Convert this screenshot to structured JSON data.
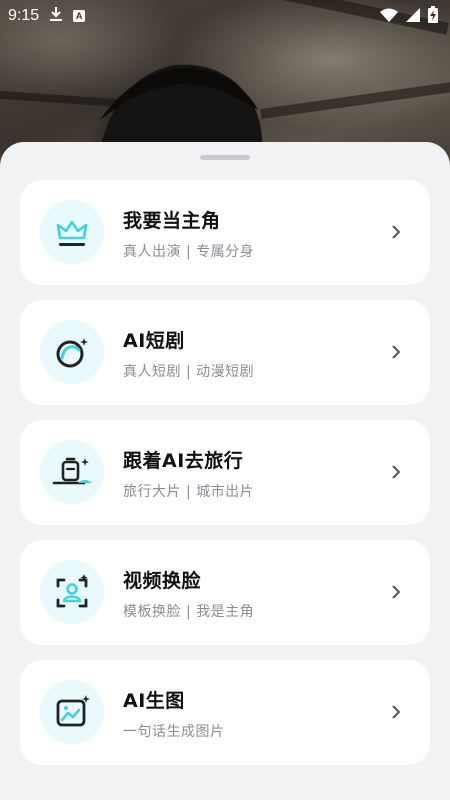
{
  "status_bar": {
    "time": "9:15",
    "icons": [
      "download-icon",
      "a-badge-icon",
      "wifi-icon",
      "signal-icon",
      "battery-charging-icon"
    ],
    "a_badge": "A"
  },
  "colors": {
    "accent": "#3fd3e0",
    "icon_dark": "#222222",
    "icon_bg": "#eaf9fb",
    "sheet_bg": "#f1f2f4",
    "subtitle": "#8a8d94"
  },
  "menu": {
    "items": [
      {
        "title": "我要当主角",
        "subtitle": "真人出演 | 专属分身",
        "icon": "crown-icon"
      },
      {
        "title": "AI短剧",
        "subtitle": "真人短剧 | 动漫短剧",
        "icon": "ai-drama-icon"
      },
      {
        "title": "跟着AI去旅行",
        "subtitle": "旅行大片 | 城市出片",
        "icon": "travel-icon"
      },
      {
        "title": "视频换脸",
        "subtitle": "模板换脸 | 我是主角",
        "icon": "face-swap-icon"
      },
      {
        "title": "AI生图",
        "subtitle": "一句话生成图片",
        "icon": "ai-image-icon"
      }
    ]
  }
}
